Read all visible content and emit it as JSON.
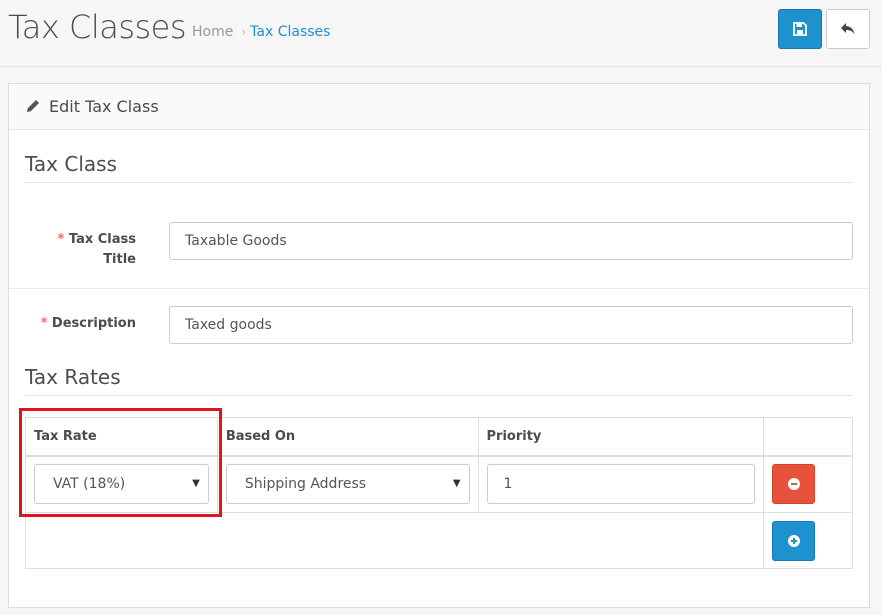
{
  "header": {
    "title": "Tax Classes",
    "breadcrumb": {
      "home": "Home",
      "separator": "›",
      "current": "Tax Classes"
    },
    "save_icon": "floppy-disk-icon",
    "back_icon": "reply-arrow-icon"
  },
  "panel": {
    "title": "Edit Tax Class",
    "title_icon": "pencil-icon"
  },
  "form": {
    "legend_tax_class": "Tax Class",
    "title_required": "*",
    "title_label_line1": "Tax Class",
    "title_label_line2": "Title",
    "title_value": "Taxable Goods",
    "description_required": "*",
    "description_label": "Description",
    "description_value": "Taxed goods",
    "legend_tax_rates": "Tax Rates"
  },
  "rates_table": {
    "headers": {
      "tax_rate": "Tax Rate",
      "based_on": "Based On",
      "priority": "Priority"
    },
    "rows": [
      {
        "tax_rate": "VAT (18%)",
        "based_on": "Shipping Address",
        "priority": "1"
      }
    ],
    "caret": "▼"
  },
  "colors": {
    "primary": "#1e91cf",
    "danger": "#e7523c",
    "highlight": "#e0141a",
    "required": "#f56b6b"
  }
}
